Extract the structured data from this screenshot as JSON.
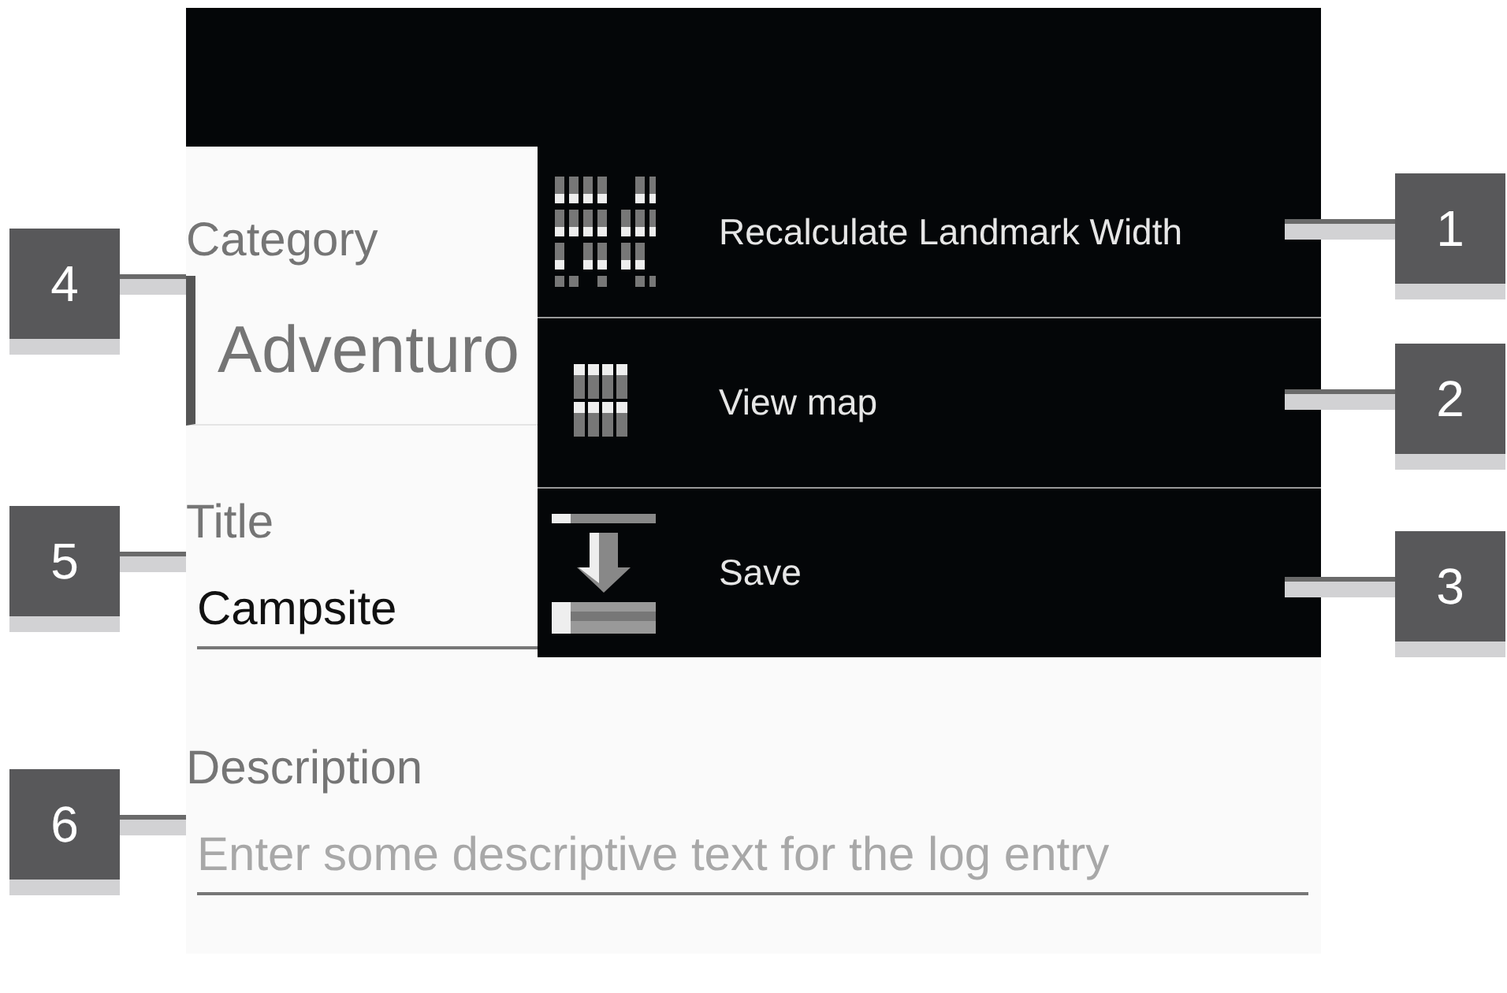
{
  "form": {
    "fields": [
      {
        "kind": "spinner",
        "label": "Category",
        "value": "Adventuro"
      },
      {
        "kind": "text",
        "label": "Title",
        "value": "Campsite"
      },
      {
        "kind": "text",
        "label": "Description",
        "placeholder": "Enter some descriptive text for the log entry"
      }
    ]
  },
  "menu": {
    "items": [
      {
        "label": "Recalculate Landmark Width"
      },
      {
        "label": "View map"
      },
      {
        "label": "Save"
      }
    ]
  },
  "callouts": [
    "4",
    "5",
    "6",
    "1",
    "2",
    "3"
  ]
}
